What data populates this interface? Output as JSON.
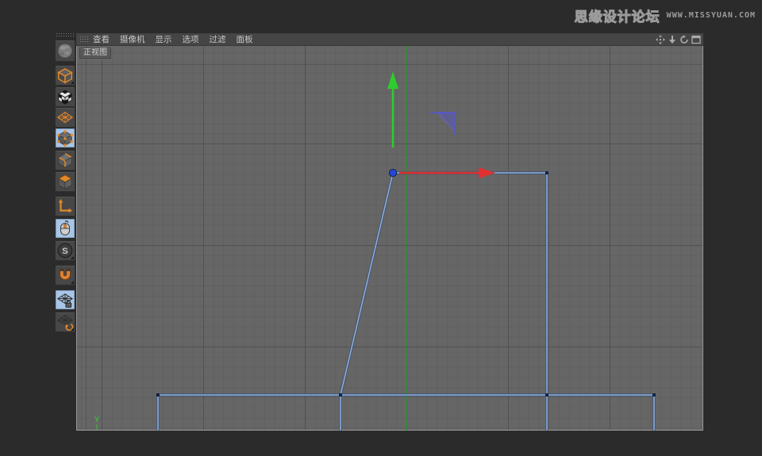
{
  "watermark": {
    "site_name": "思缘设计论坛",
    "site_url": "WWW.MISSYUAN.COM"
  },
  "menubar": {
    "items": [
      {
        "id": "view",
        "label": "查看"
      },
      {
        "id": "camera",
        "label": "摄像机"
      },
      {
        "id": "display",
        "label": "显示"
      },
      {
        "id": "options",
        "label": "选项"
      },
      {
        "id": "filter",
        "label": "过滤"
      },
      {
        "id": "panel",
        "label": "面板"
      }
    ]
  },
  "view_controls": [
    {
      "id": "pan",
      "icon": "pan-icon"
    },
    {
      "id": "zoom",
      "icon": "zoom-icon"
    },
    {
      "id": "rotate",
      "icon": "rotate-icon"
    },
    {
      "id": "toggle",
      "icon": "toggle-view-icon"
    }
  ],
  "viewport": {
    "label": "正视图",
    "axis_indicator": "Y"
  },
  "left_toolbar": {
    "tools": [
      {
        "id": "make-editable",
        "icon": "sphere-icon",
        "selected": false
      },
      {
        "id": "model-mode",
        "icon": "cube-outline-icon",
        "selected": false
      },
      {
        "id": "texture-mode",
        "icon": "checkered-cube-icon",
        "selected": false
      },
      {
        "id": "workplane-mode",
        "icon": "grid-plane-icon",
        "selected": false
      },
      {
        "id": "points-mode",
        "icon": "cube-points-icon",
        "selected": true
      },
      {
        "id": "edges-mode",
        "icon": "cube-edges-icon",
        "selected": false
      },
      {
        "id": "polygons-mode",
        "icon": "cube-face-icon",
        "selected": false
      },
      {
        "id": "axis-mode",
        "icon": "axis-l-icon",
        "selected": false
      },
      {
        "id": "tweak-mode",
        "icon": "mouse-icon",
        "selected": true
      },
      {
        "id": "snap-toggle",
        "icon": "s-circle-icon",
        "selected": false
      },
      {
        "id": "snap-settings",
        "icon": "magnet-icon",
        "selected": false
      },
      {
        "id": "workplane-lock",
        "icon": "grid-lock-icon",
        "selected": true
      },
      {
        "id": "workplane-align",
        "icon": "grid-rotate-icon",
        "selected": false
      }
    ]
  },
  "colors": {
    "spline": "#8fb4e2",
    "spline_outline": "#3d4f6e",
    "selected_point": "#2547dd",
    "point": "#16233f",
    "axis_x_arrow": "#e03030",
    "axis_y_arrow": "#2ecc2e",
    "world_axis_line": "#2f9b2f",
    "z_plane_handle": "#5858c0",
    "accent_orange": "#e2882a"
  }
}
